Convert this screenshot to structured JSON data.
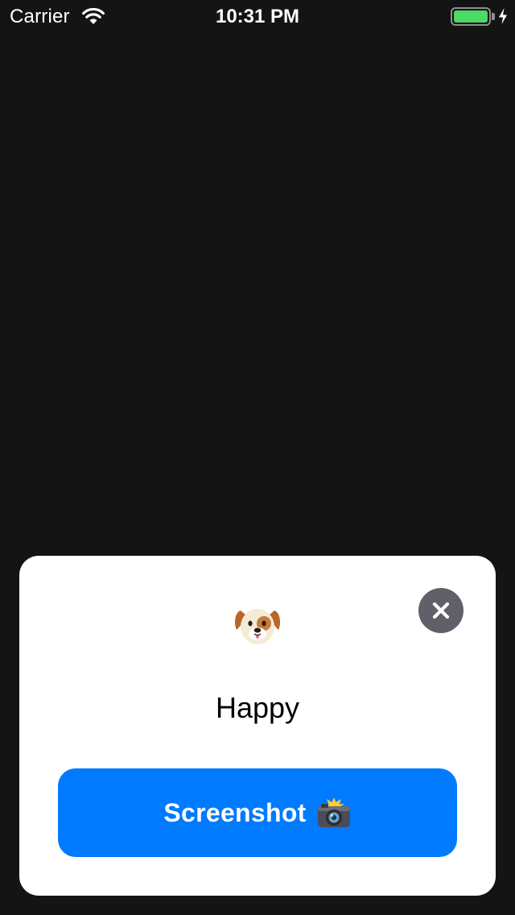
{
  "status_bar": {
    "carrier": "Carrier",
    "time": "10:31 PM",
    "wifi_icon": "wifi-icon",
    "battery_icon": "battery-full-icon",
    "charging_icon": "charging-bolt-icon",
    "battery_level": 1.0,
    "battery_color": "#4cd964"
  },
  "card": {
    "emoji_icon": "dog-face-emoji",
    "title": "Happy",
    "close_icon": "close-icon",
    "button": {
      "label": "Screenshot",
      "icon": "camera-flash-icon",
      "color": "#007aff"
    }
  },
  "colors": {
    "background": "#141414",
    "card": "#ffffff",
    "close_button": "#5f6068"
  }
}
